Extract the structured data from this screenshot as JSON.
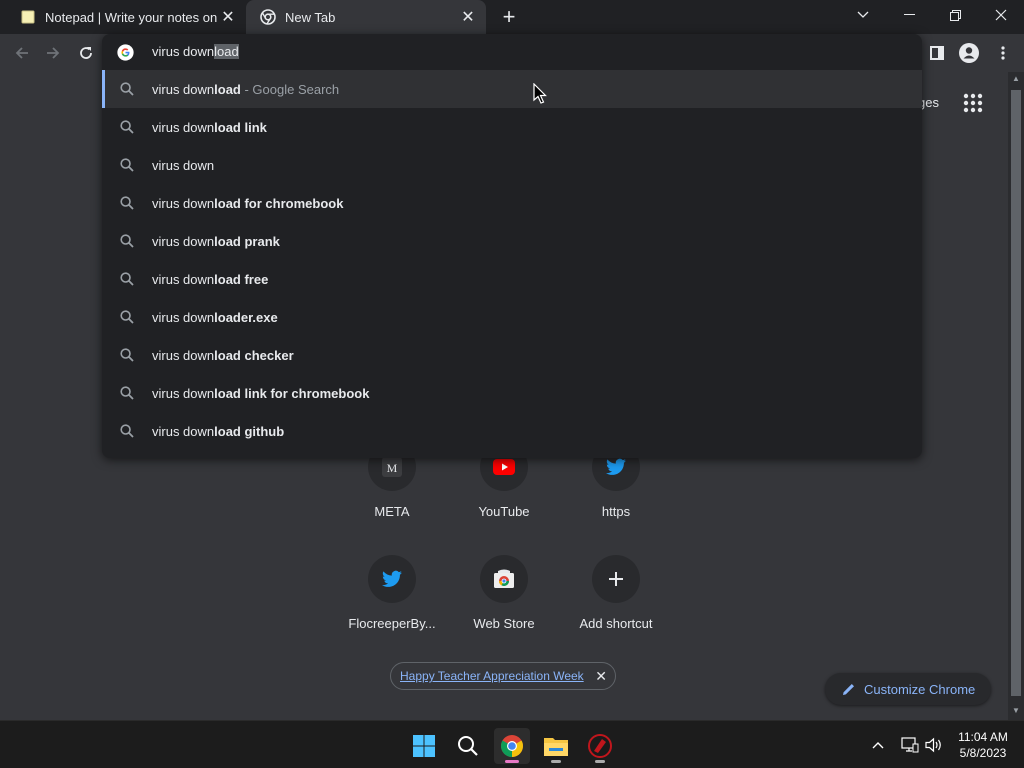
{
  "browser": {
    "tabs": [
      {
        "title": "Notepad | Write your notes online",
        "active": false
      },
      {
        "title": "New Tab",
        "active": true
      }
    ],
    "omnibox": {
      "typed": "virus down",
      "autocomplete": "load"
    }
  },
  "suggestions": [
    {
      "plain": "virus down",
      "bold": "load",
      "extra": " - Google Search",
      "highlighted": true
    },
    {
      "plain": "virus down",
      "bold": "load link",
      "extra": ""
    },
    {
      "plain": "virus down",
      "bold": "",
      "extra": ""
    },
    {
      "plain": "virus down",
      "bold": "load for chromebook",
      "extra": ""
    },
    {
      "plain": "virus down",
      "bold": "load prank",
      "extra": ""
    },
    {
      "plain": "virus down",
      "bold": "load free",
      "extra": ""
    },
    {
      "plain": "virus down",
      "bold": "loader.exe",
      "extra": ""
    },
    {
      "plain": "virus down",
      "bold": "load checker",
      "extra": ""
    },
    {
      "plain": "virus down",
      "bold": "load link for chromebook",
      "extra": ""
    },
    {
      "plain": "virus down",
      "bold": "load github",
      "extra": ""
    }
  ],
  "page": {
    "images_link": "ges",
    "shortcuts": [
      {
        "label": "META",
        "icon": "meta-icon"
      },
      {
        "label": "YouTube",
        "icon": "youtube-icon"
      },
      {
        "label": "https",
        "icon": "twitter-icon"
      },
      {
        "label": "FlocreeperBy...",
        "icon": "twitter-icon"
      },
      {
        "label": "Web Store",
        "icon": "web-store-icon"
      },
      {
        "label": "Add shortcut",
        "icon": "plus-icon"
      }
    ],
    "promo": "Happy Teacher Appreciation Week",
    "customize": "Customize Chrome"
  },
  "taskbar": {
    "time": "11:04 AM",
    "date": "5/8/2023"
  },
  "colors": {
    "accent": "#8ab4f8",
    "frame": "#202124",
    "toolbar": "#35363a"
  }
}
